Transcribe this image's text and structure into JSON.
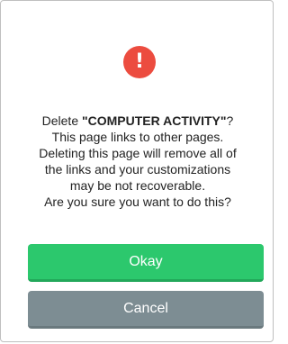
{
  "dialog": {
    "icon": "exclamation-icon",
    "icon_glyph": "!",
    "icon_color": "#ec4c3f",
    "message": {
      "line1_prefix": "Delete ",
      "page_name": "\"COMPUTER ACTIVITY\"",
      "line1_suffix": "?",
      "line2": "This page links to other pages.",
      "line3": "Deleting this page will remove all of",
      "line4": "the links and your customizations",
      "line5": "may be not recoverable.",
      "line6": "Are you sure you want to do this?"
    },
    "okay_label": "Okay",
    "okay_color": "#2cc86d",
    "cancel_label": "Cancel",
    "cancel_color": "#7d8d93"
  }
}
